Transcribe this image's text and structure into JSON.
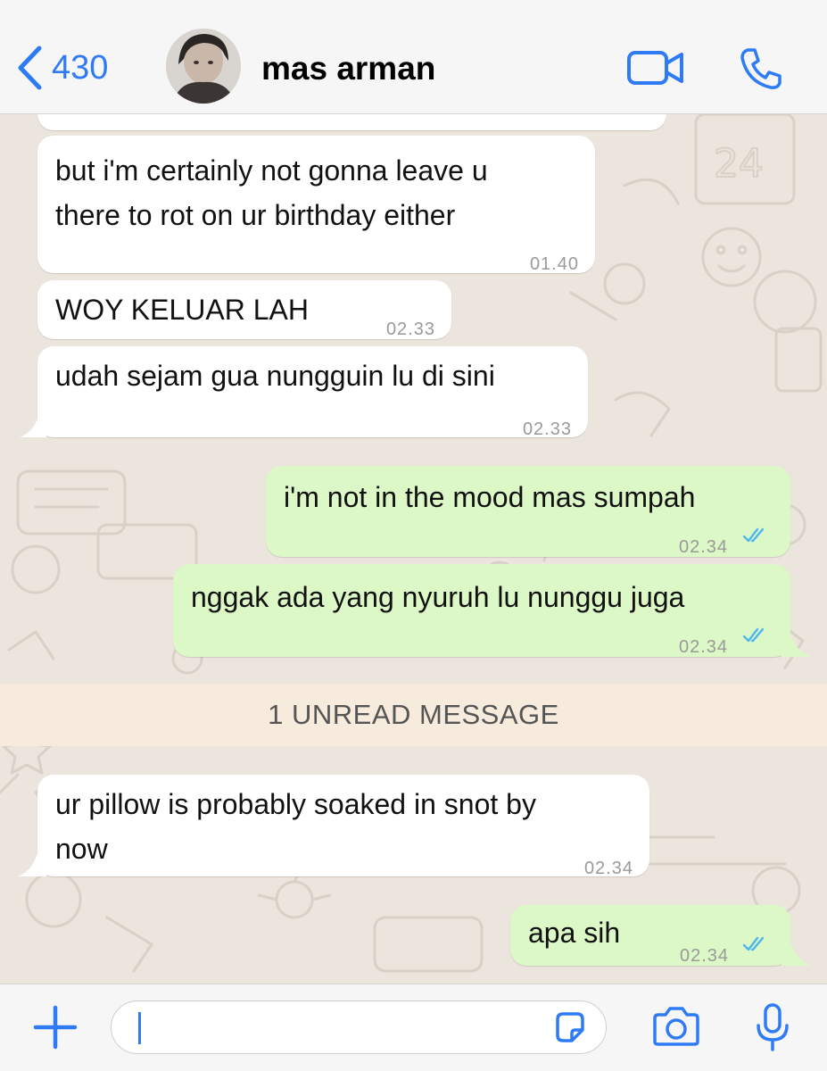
{
  "header": {
    "back_count": "430",
    "contact_name": "mas arman",
    "icons": {
      "back": "chevron-left-icon",
      "video": "video-camera-icon",
      "call": "phone-icon"
    }
  },
  "messages": [
    {
      "direction": "incoming",
      "text": "but i'm certainly not gonna leave u\nthere to rot on ur birthday either",
      "time": "01.40"
    },
    {
      "direction": "incoming",
      "text": "WOY KELUAR LAH",
      "time": "02.33"
    },
    {
      "direction": "incoming",
      "text": "udah sejam gua nungguin lu di sini",
      "time": "02.33"
    },
    {
      "direction": "outgoing",
      "text": "i'm not in the mood mas sumpah",
      "time": "02.34",
      "status": "read"
    },
    {
      "direction": "outgoing",
      "text": "nggak ada yang nyuruh lu nunggu juga",
      "time": "02.34",
      "status": "read"
    },
    {
      "direction": "incoming",
      "text": "ur pillow is probably soaked in snot by\nnow",
      "time": "02.34"
    },
    {
      "direction": "outgoing",
      "text": "apa sih",
      "time": "02.34",
      "status": "read"
    }
  ],
  "unread_banner": "1 UNREAD MESSAGE",
  "footer": {
    "input_value": "",
    "icons": {
      "add": "plus-icon",
      "sticker": "sticker-icon",
      "camera": "camera-icon",
      "mic": "microphone-icon"
    }
  },
  "colors": {
    "accent": "#2F7BF6",
    "incoming_bubble": "#FFFFFF",
    "outgoing_bubble": "#DCF8C6",
    "chat_background": "#ECE5DD",
    "unread_banner_bg": "#F6EBDD",
    "read_ticks": "#4FB6EC"
  }
}
